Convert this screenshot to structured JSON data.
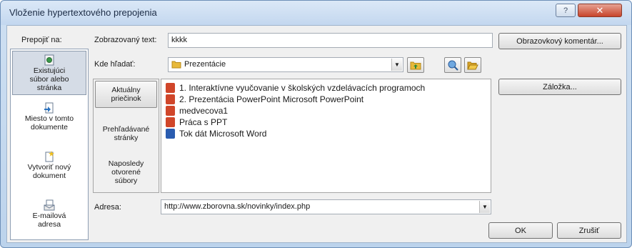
{
  "window": {
    "title": "Vloženie hypertextového prepojenia",
    "help_label": "?",
    "close_label": "✕"
  },
  "link_to": {
    "label": "Prepojiť na:",
    "items": [
      {
        "label": "Existujúci\nsúbor alebo\nstránka",
        "icon": "existing-file-icon",
        "selected": true
      },
      {
        "label": "Miesto v tomto\ndokumente",
        "icon": "place-in-document-icon",
        "selected": false
      },
      {
        "label": "Vytvoriť nový\ndokument",
        "icon": "new-document-icon",
        "selected": false
      },
      {
        "label": "E-mailová\nadresa",
        "icon": "email-address-icon",
        "selected": false
      }
    ]
  },
  "display_text": {
    "label": "Zobrazovaný text:",
    "value": "kkkk"
  },
  "screentip_button": "Obrazovkový komentár...",
  "look_in": {
    "label": "Kde hľadať:",
    "value": "Prezentácie"
  },
  "side_tabs": [
    {
      "label": "Aktuálny\npriečinok",
      "selected": true
    },
    {
      "label": "Prehľadávané\nstránky",
      "selected": false
    },
    {
      "label": "Naposledy\notvorené\nsúbory",
      "selected": false
    }
  ],
  "files": [
    {
      "name": "1. Interaktívne vyučovanie v školských vzdelávacích programoch",
      "type": "powerpoint"
    },
    {
      "name": "2. Prezentácia PowerPoint Microsoft PowerPoint",
      "type": "powerpoint"
    },
    {
      "name": "medvecova1",
      "type": "powerpoint"
    },
    {
      "name": "Práca s PPT",
      "type": "powerpoint"
    },
    {
      "name": "Tok dát Microsoft Word",
      "type": "word"
    }
  ],
  "bookmark_button": "Záložka...",
  "address": {
    "label": "Adresa:",
    "value": "http://www.zborovna.sk/novinky/index.php"
  },
  "ok_button": "OK",
  "cancel_button": "Zrušiť",
  "colors": {
    "powerpoint": "#d0462a",
    "word": "#2a5cb0",
    "folder": "#e8b93a"
  }
}
